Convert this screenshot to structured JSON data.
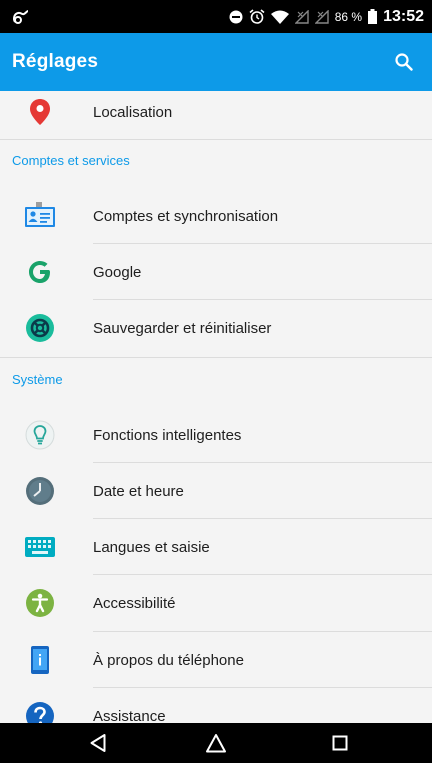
{
  "status_bar": {
    "battery_percent": "86 %",
    "time": "13:52",
    "icons": [
      "app-notification-icon",
      "do-not-disturb-icon",
      "alarm-icon",
      "wifi-icon",
      "no-sim-icon",
      "signal-icon",
      "battery-icon"
    ]
  },
  "app_bar": {
    "title": "Réglages",
    "search_icon": "search-icon",
    "color": "#0d9ae8"
  },
  "items": {
    "localisation": "Localisation",
    "comptes_sync": "Comptes et synchronisation",
    "google": "Google",
    "sauvegarder": "Sauvegarder et réinitialiser",
    "fonctions": "Fonctions intelligentes",
    "date": "Date et heure",
    "langues": "Langues et saisie",
    "accessibilite": "Accessibilité",
    "a_propos": "À propos du téléphone",
    "assistance": "Assistance"
  },
  "sections": {
    "comptes": "Comptes et services",
    "systeme": "Système"
  },
  "navigation": {
    "icons": [
      "back-icon",
      "home-icon",
      "recents-icon"
    ]
  }
}
